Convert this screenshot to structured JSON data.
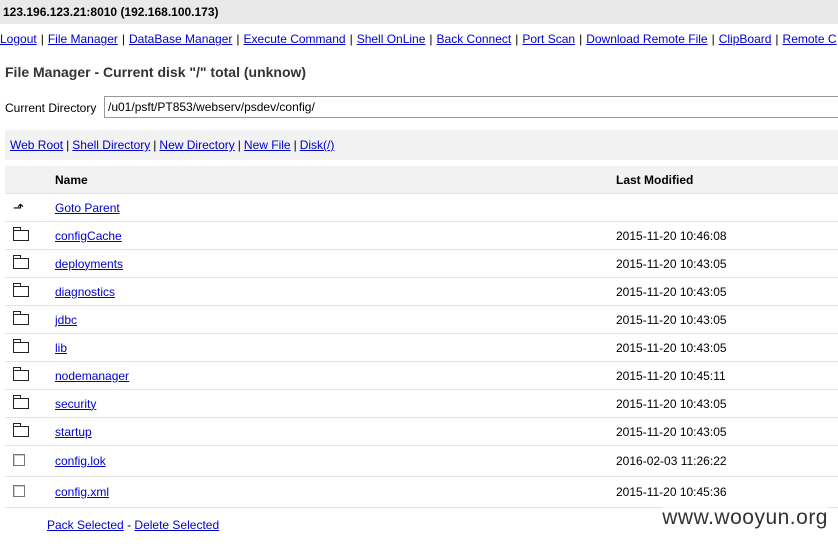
{
  "host": "123.196.123.21:8010 (192.168.100.173)",
  "menu": [
    "Logout",
    "File Manager",
    "DataBase Manager",
    "Execute Command",
    "Shell OnLine",
    "Back Connect",
    "Port Scan",
    "Download Remote File",
    "ClipBoard",
    "Remote C"
  ],
  "title": "File Manager - Current disk \"/\" total (unknow)",
  "current_dir_label": "Current Directory",
  "current_dir_value": "/u01/psft/PT853/webserv/psdev/config/",
  "sublinks": [
    "Web Root",
    "Shell Directory",
    "New Directory",
    "New File",
    "Disk(/)"
  ],
  "table": {
    "headers": {
      "name": "Name",
      "modified": "Last Modified"
    },
    "parent": {
      "label": "Goto Parent",
      "icon": "up-arrow-icon"
    },
    "rows": [
      {
        "icon": "folder-icon",
        "name": "configCache",
        "modified": "2015-11-20 10:46:08"
      },
      {
        "icon": "folder-icon",
        "name": "deployments",
        "modified": "2015-11-20 10:43:05"
      },
      {
        "icon": "folder-icon",
        "name": "diagnostics",
        "modified": "2015-11-20 10:43:05"
      },
      {
        "icon": "folder-icon",
        "name": "jdbc",
        "modified": "2015-11-20 10:43:05"
      },
      {
        "icon": "folder-icon",
        "name": "lib",
        "modified": "2015-11-20 10:43:05"
      },
      {
        "icon": "folder-icon",
        "name": "nodemanager",
        "modified": "2015-11-20 10:45:11"
      },
      {
        "icon": "folder-icon",
        "name": "security",
        "modified": "2015-11-20 10:43:05"
      },
      {
        "icon": "folder-icon",
        "name": "startup",
        "modified": "2015-11-20 10:43:05"
      },
      {
        "icon": "checkbox",
        "name": "config.lok",
        "modified": "2016-02-03 11:26:22"
      },
      {
        "icon": "checkbox",
        "name": "config.xml",
        "modified": "2015-11-20 10:45:36"
      }
    ]
  },
  "footer": {
    "pack": "Pack Selected",
    "sep": "-",
    "delete": "Delete Selected"
  },
  "watermark": "www.wooyun.org"
}
